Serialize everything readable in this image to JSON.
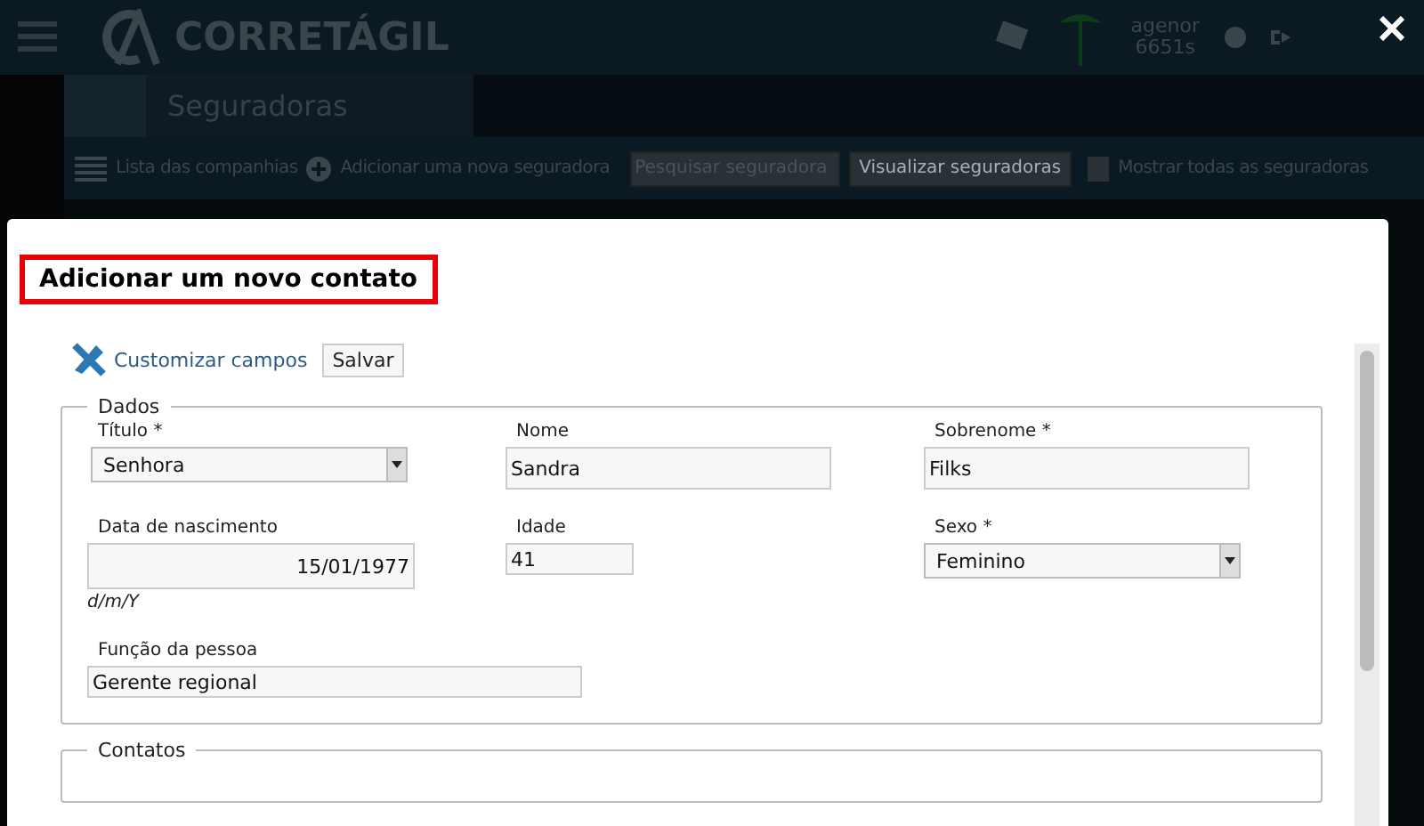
{
  "app": {
    "brand": "CORRETÁGIL",
    "user": {
      "name": "agenor",
      "code": "6651s"
    }
  },
  "page": {
    "title": "Seguradoras",
    "list_link": "Lista das companhias",
    "add_link": "Adicionar uma nova seguradora",
    "search": {
      "placeholder": "Pesquisar seguradora"
    },
    "view_button": "Visualizar seguradoras",
    "show_all": {
      "label": "Mostrar todas as seguradoras",
      "checked": false
    }
  },
  "modal": {
    "title": "Adicionar um novo contato",
    "customize_link": "Customizar campos",
    "save_button": "Salvar",
    "sections": [
      {
        "legend": "Dados",
        "fields": [
          {
            "kind": "select",
            "label": "Título *",
            "value": "Senhora"
          },
          {
            "kind": "text",
            "label": "Nome",
            "value": "Sandra"
          },
          {
            "kind": "text",
            "label": "Sobrenome *",
            "value": "Filks"
          },
          {
            "kind": "date",
            "label": "Data de nascimento",
            "value": "15/01/1977",
            "hint": "d/m/Y"
          },
          {
            "kind": "text",
            "label": "Idade",
            "value": "41"
          },
          {
            "kind": "select",
            "label": "Sexo *",
            "value": "Feminino"
          },
          {
            "kind": "text",
            "label": "Função da pessoa",
            "value": "Gerente regional"
          }
        ]
      },
      {
        "legend": "Contatos"
      }
    ]
  }
}
